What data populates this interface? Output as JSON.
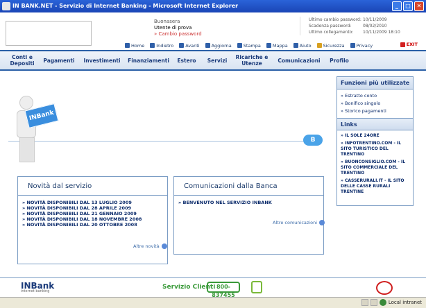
{
  "window": {
    "title": "IN BANK.NET - Servizio di Internet Banking - Microsoft Internet Explorer"
  },
  "header": {
    "greeting": "Buonasera",
    "user": "Utente di prova",
    "change_password": "» Cambio password",
    "info": [
      {
        "label": "Ultimo cambio password:",
        "value": "10/11/2009"
      },
      {
        "label": "Scadenza password:",
        "value": "08/02/2010"
      },
      {
        "label": "Ultimo collegamento:",
        "value": "10/11/2009 18:10"
      }
    ]
  },
  "toolbar": {
    "home": "Home",
    "back": "Indietro",
    "forward": "Avanti",
    "refresh": "Aggiorna",
    "print": "Stampa",
    "map": "Mappa",
    "help": "Aiuto",
    "security": "Sicurezza",
    "privacy": "Privacy",
    "exit": "EXIT"
  },
  "nav": [
    "Conti e Depositi",
    "Pagamenti",
    "Investimenti",
    "Finanziamenti",
    "Estero",
    "Servizi",
    "Ricariche e Utenze",
    "Comunicazioni",
    "Profilo"
  ],
  "banner": {
    "sign_text": "INBank",
    "bubble_text": "B"
  },
  "news": {
    "title": "Novità dal servizio",
    "items": [
      "» NOVITÀ DISPONIBILI DAL 13 LUGLIO 2009",
      "» NOVITÀ DISPONIBILI DAL 28 APRILE 2009",
      "» NOVITÀ DISPONIBILI DAL 21 GENNAIO 2009",
      "» NOVITÀ DISPONIBILI DAL 18 NOVEMBRE 2008",
      "» NOVITÀ DISPONIBILI DAL 20 OTTOBRE 2008"
    ],
    "more": "Altre novità"
  },
  "comms": {
    "title": "Comunicazioni dalla Banca",
    "items": [
      "» BENVENUTO NEL SERVIZIO INBANK"
    ],
    "more": "Altre comunicazioni"
  },
  "sidebar": {
    "functions_title": "Funzioni più utilizzate",
    "functions": [
      "» Estratto conto",
      "» Bonifico singolo",
      "» Storico pagamenti"
    ],
    "links_title": "Links",
    "links": [
      "» IL SOLE 24ORE",
      "» INFOTRENTINO.COM - IL SITO TURISTICO DEL TRENTINO",
      "» BUONCONSIGLIO.COM - IL SITO COMMERCIALE DEL TRENTINO",
      "» CASSERURALI.IT - IL SITO DELLE CASSE RURALI TRENTINE"
    ]
  },
  "footer": {
    "logo": "INBank",
    "logo_sub": "internet banking",
    "service": "Servizio Clienti",
    "phone": "800-837455"
  },
  "statusbar": {
    "zone": "Local intranet"
  }
}
